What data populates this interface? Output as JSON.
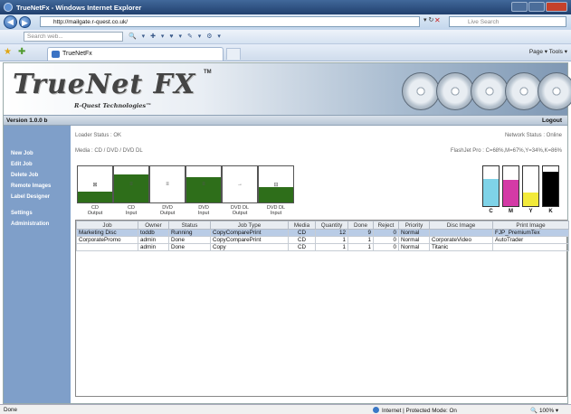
{
  "window": {
    "title": "TrueNetFx - Windows Internet Explorer"
  },
  "addressbar": {
    "url": "http://mailgate.r-quest.co.uk/",
    "search_placeholder": "Live Search"
  },
  "searchbar": {
    "placeholder": "Search web..."
  },
  "tab": {
    "label": "TrueNetFx"
  },
  "commandbar": {
    "text": "Page ▾  Tools ▾"
  },
  "app": {
    "logo": "TrueNet FX",
    "trademark": "TM",
    "subtitle": "R-Quest Technologies™",
    "version": "Version 1.0.0 b",
    "logout": "Logout",
    "loader_status": "Loader Status : OK",
    "media": "Media : CD / DVD / DVD DL",
    "network_status": "Network Status : Online",
    "flashjet": "FlashJet Pro : C=68%,M=67%,Y=34%,K=86%"
  },
  "sidebar": {
    "items": [
      {
        "label": "New Job"
      },
      {
        "label": "Edit Job"
      },
      {
        "label": "Delete Job"
      },
      {
        "label": "Remote Images"
      },
      {
        "label": "Label Designer"
      },
      {
        "label": "Settings"
      },
      {
        "label": "Administration"
      }
    ]
  },
  "drives": [
    {
      "label1": "CD",
      "label2": "Output",
      "glyph": "⊠",
      "fill": 0.3
    },
    {
      "label1": "CD",
      "label2": "Input",
      "glyph": "≡",
      "fill": 0.78
    },
    {
      "label1": "DVD",
      "label2": "Output",
      "glyph": "≡",
      "fill": 0.0
    },
    {
      "label1": "DVD",
      "label2": "Input",
      "glyph": "≡",
      "fill": 0.7
    },
    {
      "label1": "DVD DL",
      "label2": "Output",
      "glyph": "→",
      "fill": 0.0
    },
    {
      "label1": "DVD DL",
      "label2": "Input",
      "glyph": "⊟",
      "fill": 0.42
    }
  ],
  "inks": [
    {
      "label": "C",
      "color": "#7fd3e8",
      "level": 0.68
    },
    {
      "label": "M",
      "color": "#d43aa6",
      "level": 0.67
    },
    {
      "label": "Y",
      "color": "#f2ea3a",
      "level": 0.34
    },
    {
      "label": "K",
      "color": "#000000",
      "level": 0.86
    }
  ],
  "jobs": {
    "columns": [
      "Job",
      "Owner",
      "Status",
      "Job Type",
      "Media",
      "Quantity",
      "Done",
      "Reject",
      "Priority",
      "Disc Image",
      "Print Image"
    ],
    "rows": [
      [
        "Marketing Disc",
        "toddb",
        "Running",
        "CopyComparePrint",
        "CD",
        "12",
        "9",
        "0",
        "Normal",
        "",
        "FJP_PremiumTex"
      ],
      [
        "CorporatePromo",
        "admin",
        "Done",
        "CopyComparePrint",
        "CD",
        "1",
        "1",
        "0",
        "Normal",
        "CorporateVideo",
        "AutoTrader"
      ],
      [
        "",
        "admin",
        "Done",
        "Copy",
        "CD",
        "1",
        "1",
        "0",
        "Normal",
        "Titanic",
        ""
      ]
    ]
  },
  "statusbar": {
    "left": "Done",
    "zone": "Internet | Protected Mode: On",
    "zoom": "100%"
  }
}
